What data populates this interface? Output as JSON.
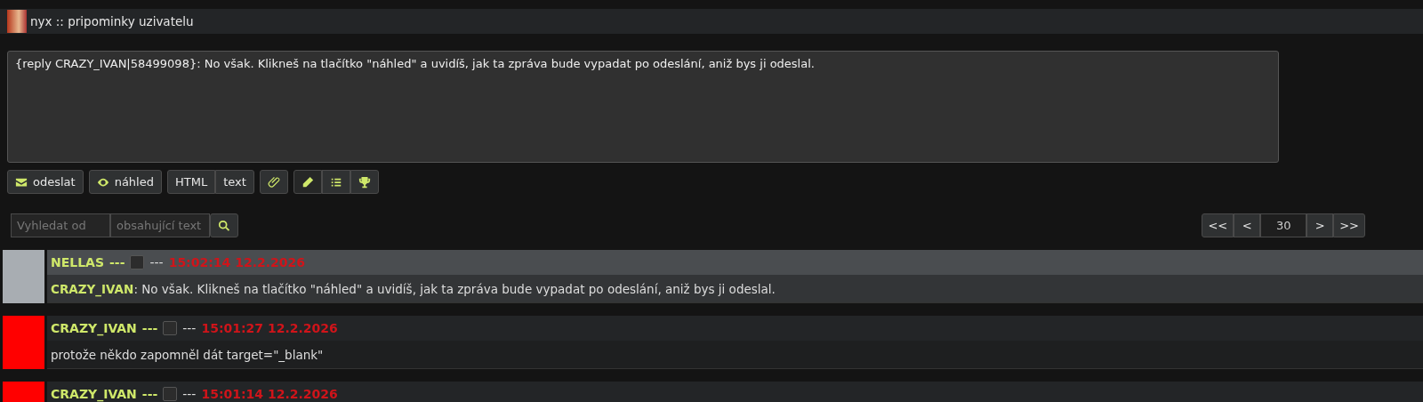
{
  "header": {
    "title": "nyx :: pripominky uzivatelu"
  },
  "composer": {
    "value": "{reply CRAZY_IVAN|58499098}: No však. Klikneš na tlačítko \"náhled\" a uvidíš, jak ta zpráva bude vypadat po odeslání, aniž bys ji odeslal."
  },
  "toolbar": {
    "send": "odeslat",
    "preview": "náhled",
    "formats": [
      "HTML",
      "text"
    ]
  },
  "search": {
    "from_placeholder": "Vyhledat od",
    "text_placeholder": "obsahující text"
  },
  "pagination": {
    "first": "<<",
    "prev": "<",
    "page": "30",
    "next": ">",
    "last": ">>"
  },
  "posts": [
    {
      "author": "NELLAS",
      "sep1": "---",
      "checked": false,
      "sep2": "---",
      "time": "15:02:14 12.2.2026",
      "selected": true,
      "reply_to": "CRAZY_IVAN",
      "body": ": No však. Klikneš na tlačítko \"náhled\" a uvidíš, jak ta zpráva bude vypadat po odeslání, aniž bys ji odeslal.",
      "color": "#a8adb2"
    },
    {
      "author": "CRAZY_IVAN",
      "sep1": "---",
      "checked": false,
      "sep2": "---",
      "time": "15:01:27 12.2.2026",
      "selected": false,
      "body": "protože někdo zapomněl dát target=\"_blank\"",
      "color": "#ff0000"
    },
    {
      "author": "CRAZY_IVAN",
      "sep1": "---",
      "checked": false,
      "sep2": "---",
      "time": "15:01:14 12.2.2026",
      "selected": false,
      "color": "#ff0000"
    }
  ]
}
